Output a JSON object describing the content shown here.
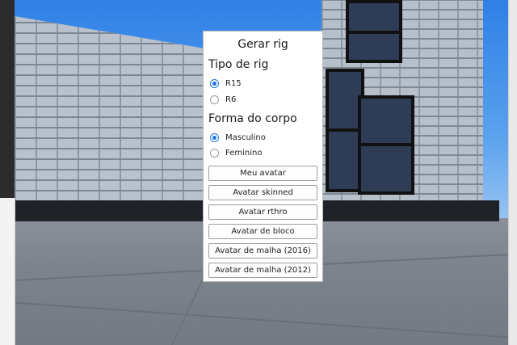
{
  "dialog": {
    "title": "Gerar rig",
    "rig_section": {
      "title": "Tipo de rig",
      "options": [
        {
          "label": "R15",
          "selected": true
        },
        {
          "label": "R6",
          "selected": false
        }
      ]
    },
    "body_section": {
      "title": "Forma do corpo",
      "options": [
        {
          "label": "Masculino",
          "selected": true
        },
        {
          "label": "Feminino",
          "selected": false
        }
      ]
    },
    "buttons": [
      "Meu avatar",
      "Avatar skinned",
      "Avatar rthro",
      "Avatar de bloco",
      "Avatar de malha (2016)",
      "Avatar de malha (2012)"
    ]
  },
  "panel": {
    "close_glyph": "×"
  },
  "colors": {
    "accent": "#1a73e8",
    "dialog_bg": "#ffffff",
    "sky": "#3a86e8"
  }
}
